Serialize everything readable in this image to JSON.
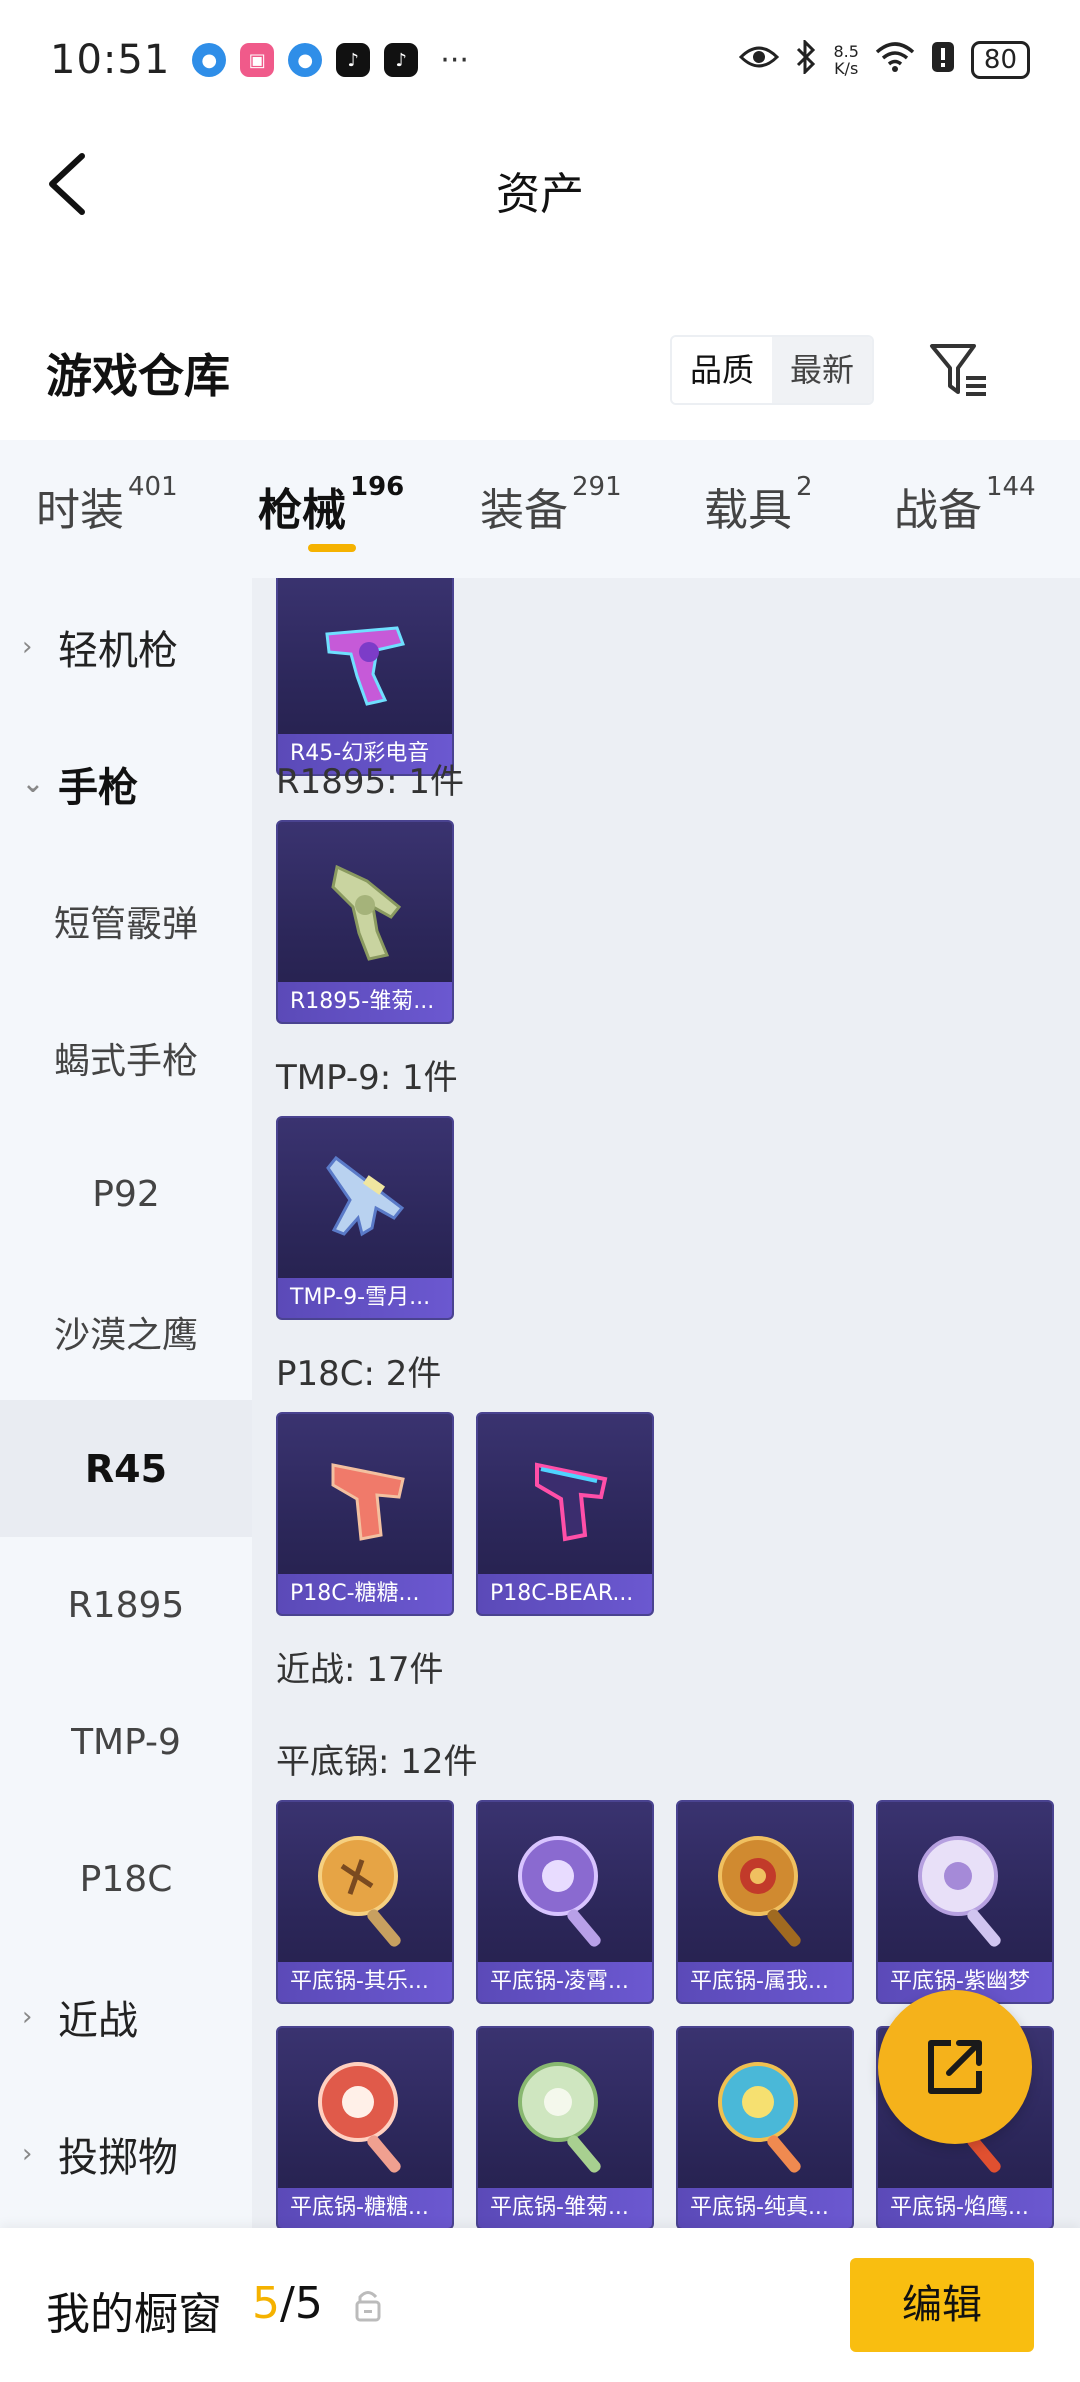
{
  "status_bar": {
    "time": "10:51",
    "app_icons": [
      "browser-icon",
      "bilibili-icon",
      "browser-icon",
      "tiktok-icon",
      "tiktok-icon"
    ],
    "more": "···",
    "speed_value": "8.5",
    "speed_unit": "K/s",
    "battery": "80"
  },
  "header": {
    "title": "资产"
  },
  "warehouse": {
    "title": "游戏仓库",
    "sort_options": [
      "品质",
      "最新"
    ],
    "sort_selected": "品质"
  },
  "tabs": [
    {
      "label": "时装",
      "count": "401"
    },
    {
      "label": "枪械",
      "count": "196",
      "active": true
    },
    {
      "label": "装备",
      "count": "291"
    },
    {
      "label": "载具",
      "count": "2"
    },
    {
      "label": "战备",
      "count": "144"
    }
  ],
  "sidebar": {
    "items": [
      {
        "label": "轻机枪",
        "type": "group-collapsed"
      },
      {
        "label": "手枪",
        "type": "group-expanded"
      },
      {
        "label": "短管霰弹"
      },
      {
        "label": "蝎式手枪"
      },
      {
        "label": "P92"
      },
      {
        "label": "沙漠之鹰"
      },
      {
        "label": "R45",
        "selected": true
      },
      {
        "label": "R1895"
      },
      {
        "label": "TMP-9"
      },
      {
        "label": "P18C"
      },
      {
        "label": "近战",
        "type": "group-collapsed"
      },
      {
        "label": "投掷物",
        "type": "group-collapsed"
      }
    ]
  },
  "content": {
    "sections": [
      {
        "label": "",
        "items": [
          "R45-幻彩电音"
        ]
      },
      {
        "label": "R1895: 1件",
        "items": [
          "R1895-雏菊..."
        ]
      },
      {
        "label": "TMP-9: 1件",
        "items": [
          "TMP-9-雪月..."
        ]
      },
      {
        "label": "P18C: 2件",
        "items": [
          "P18C-糖糖...",
          "P18C-BEAR..."
        ]
      },
      {
        "label": "近战: 17件",
        "items": []
      },
      {
        "label": "平底锅: 12件",
        "items": [
          "平底锅-其乐...",
          "平底锅-凌霄...",
          "平底锅-属我...",
          "平底锅-紫幽梦",
          "平底锅-糖糖...",
          "平底锅-雏菊...",
          "平底锅-纯真...",
          "平底锅-焰鹰..."
        ]
      }
    ]
  },
  "bottom_bar": {
    "label": "我的橱窗",
    "current": "5",
    "separator": "/",
    "total": "5",
    "edit_label": "编辑"
  },
  "colors": {
    "accent": "#f5b200",
    "card_bg": "#2c275a",
    "card_label": "#5b4ab8",
    "sidebar_bg": "#f4f7fb",
    "content_bg": "#eceff4"
  }
}
